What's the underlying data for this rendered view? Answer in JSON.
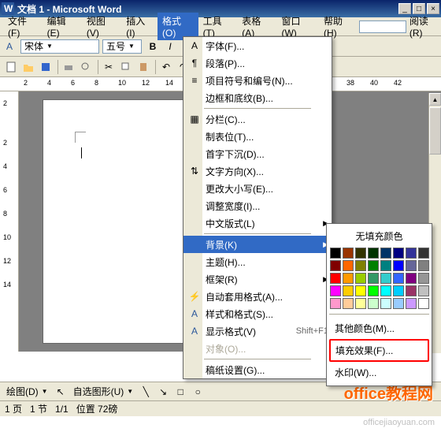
{
  "title": "文档 1 - Microsoft Word",
  "menu": {
    "file": "文件(F)",
    "edit": "编辑(E)",
    "view": "视图(V)",
    "insert": "插入(I)",
    "format": "格式(O)",
    "tools": "工具(T)",
    "table": "表格(A)",
    "window": "窗口(W)",
    "help": "帮助(H)",
    "read": "阅读(R)"
  },
  "font": {
    "name": "宋体",
    "size": "五号"
  },
  "format_menu": {
    "font": "字体(F)...",
    "paragraph": "段落(P)...",
    "bullets": "项目符号和编号(N)...",
    "borders": "边框和底纹(B)...",
    "columns": "分栏(C)...",
    "tabs": "制表位(T)...",
    "dropcap": "首字下沉(D)...",
    "textdir": "文字方向(X)...",
    "changecase": "更改大小写(E)...",
    "fitwidth": "调整宽度(I)...",
    "asianlayout": "中文版式(L)",
    "background": "背景(K)",
    "theme": "主题(H)...",
    "frames": "框架(R)",
    "autoformat": "自动套用格式(A)...",
    "styles": "样式和格式(S)...",
    "revealformat": "显示格式(V)",
    "revealformat_key": "Shift+F1",
    "object": "对象(O)...",
    "manuscript": "稿纸设置(G)..."
  },
  "bg_submenu": {
    "nofill": "无填充颜色",
    "morecolors": "其他颜色(M)...",
    "filleffects": "填充效果(F)...",
    "watermark": "水印(W)..."
  },
  "colors": [
    "#000000",
    "#993300",
    "#333300",
    "#003300",
    "#003366",
    "#000080",
    "#333399",
    "#333333",
    "#800000",
    "#ff6600",
    "#808000",
    "#008000",
    "#008080",
    "#0000ff",
    "#666699",
    "#808080",
    "#ff0000",
    "#ff9900",
    "#99cc00",
    "#339966",
    "#33cccc",
    "#3366ff",
    "#800080",
    "#969696",
    "#ff00ff",
    "#ffcc00",
    "#ffff00",
    "#00ff00",
    "#00ffff",
    "#00ccff",
    "#993366",
    "#c0c0c0",
    "#ff99cc",
    "#ffcc99",
    "#ffff99",
    "#ccffcc",
    "#ccffff",
    "#99ccff",
    "#cc99ff",
    "#ffffff"
  ],
  "ruler_h": [
    "2",
    "4",
    "6",
    "8",
    "10",
    "12",
    "14",
    "38",
    "40",
    "42"
  ],
  "ruler_v": [
    "2",
    "2",
    "4",
    "6",
    "8",
    "10",
    "12",
    "14"
  ],
  "status": {
    "page": "1 页",
    "section": "1 节",
    "pageof": "1/1",
    "position": "位置  72磅"
  },
  "drawbar": {
    "draw": "绘图(D)",
    "autoshapes": "自选图形(U)"
  },
  "watermark_text": "office教程网",
  "watermark_url": "officejiaoyuan.com"
}
